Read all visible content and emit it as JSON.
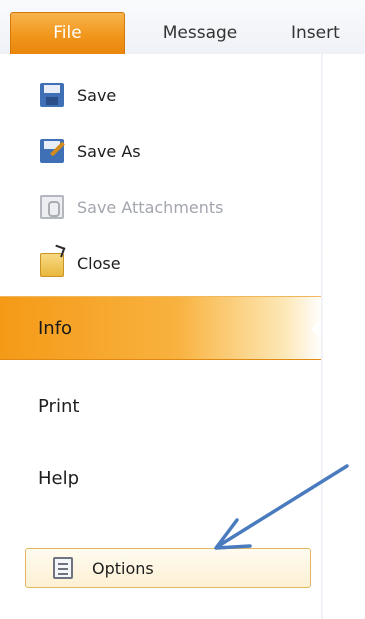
{
  "ribbon": {
    "tabs": [
      {
        "label": "File"
      },
      {
        "label": "Message"
      },
      {
        "label": "Insert"
      }
    ]
  },
  "backstage": {
    "commands": [
      {
        "label": "Save",
        "icon": "save-icon",
        "enabled": true
      },
      {
        "label": "Save As",
        "icon": "save-as-icon",
        "enabled": true
      },
      {
        "label": "Save Attachments",
        "icon": "save-attachments-icon",
        "enabled": false
      },
      {
        "label": "Close",
        "icon": "folder-close-icon",
        "enabled": true
      }
    ],
    "nav": [
      {
        "label": "Info",
        "selected": true
      },
      {
        "label": "Print",
        "selected": false
      },
      {
        "label": "Help",
        "selected": false
      }
    ],
    "options": {
      "label": "Options",
      "icon": "options-icon"
    }
  },
  "colors": {
    "accent_orange": "#f1961c",
    "annotation_arrow": "#4a7bbf"
  },
  "annotation": {
    "type": "arrow",
    "points_to": "options-button"
  }
}
